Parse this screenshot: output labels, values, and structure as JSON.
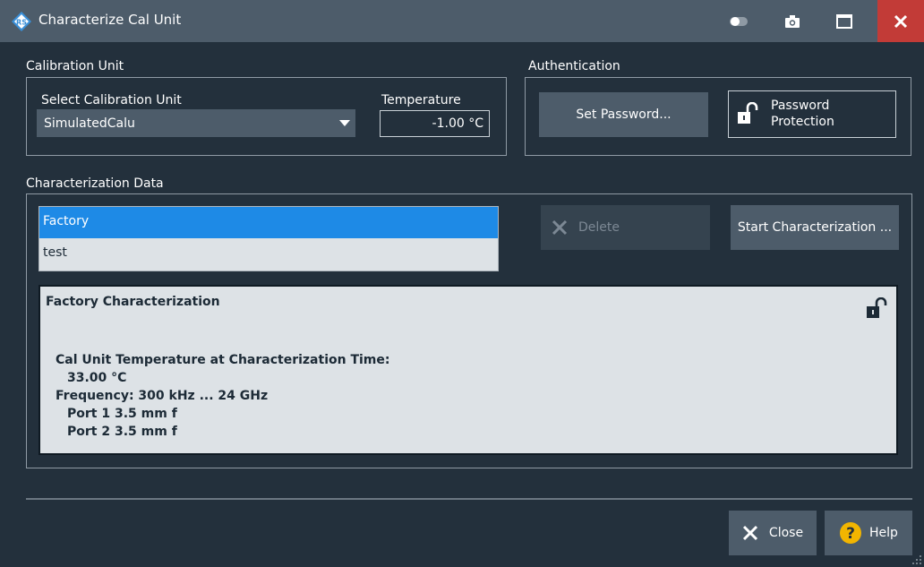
{
  "window": {
    "title": "Characterize Cal Unit",
    "icons": [
      "rohde-schwarz-logo",
      "toggle-icon",
      "camera-icon",
      "maximize-icon",
      "close-icon"
    ]
  },
  "calibration_unit": {
    "group_title": "Calibration Unit",
    "select_label": "Select Calibration Unit",
    "selected_value": "SimulatedCalu",
    "temperature_label": "Temperature",
    "temperature_value": "-1.00 °C"
  },
  "authentication": {
    "group_title": "Authentication",
    "set_password_label": "Set Password...",
    "password_protection_line1": "Password",
    "password_protection_line2": "Protection"
  },
  "characterization": {
    "group_title": "Characterization Data",
    "items": [
      {
        "label": "Factory",
        "selected": true
      },
      {
        "label": "test",
        "selected": false
      }
    ],
    "delete_label": "Delete",
    "start_label": "Start Characterization ..."
  },
  "details": {
    "heading": "Factory Characterization",
    "temp_label": "Cal Unit Temperature at Characterization Time:",
    "temp_value": "33.00 °C",
    "frequency": "Frequency: 300 kHz ... 24 GHz",
    "port1": "Port 1 3.5 mm f",
    "port2": "Port 2 3.5 mm f"
  },
  "footer": {
    "close_label": "Close",
    "help_label": "Help"
  },
  "colors": {
    "background": "#23303c",
    "titlebar": "#4d5c6a",
    "close_red": "#c23b37",
    "selection_blue": "#1e8ae6",
    "help_yellow": "#f2b500"
  }
}
